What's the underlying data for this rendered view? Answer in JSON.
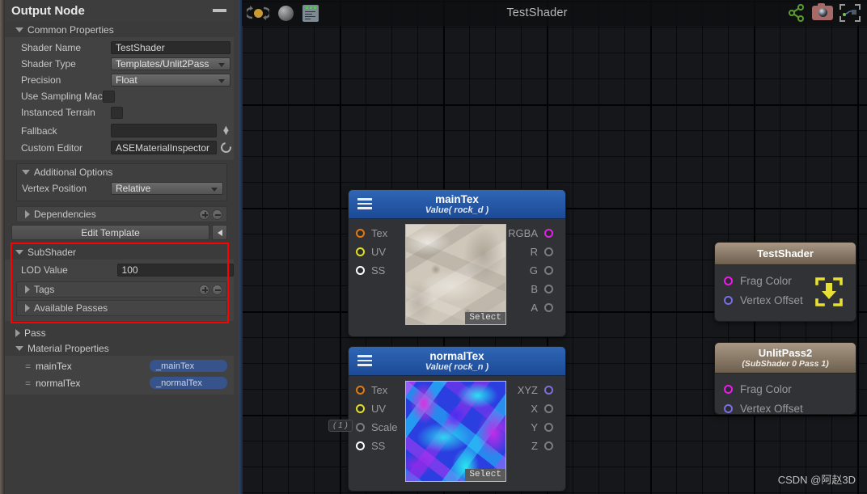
{
  "window": {
    "sidebar_title": "Output Node",
    "minimize_label": "minimize"
  },
  "toolbar": {
    "title": "TestShader",
    "icons": [
      "refresh-icon",
      "sphere-preview-icon",
      "document-icon"
    ],
    "right_icons": [
      "share-icon",
      "camera-icon",
      "focus-icon"
    ]
  },
  "sidebar": {
    "common_properties": {
      "label": "Common Properties",
      "fields": [
        {
          "label": "Shader Name",
          "value": "TestShader",
          "type": "text"
        },
        {
          "label": "Shader Type",
          "value": "Templates/Unlit2Pass",
          "type": "dropdown"
        },
        {
          "label": "Precision",
          "value": "Float",
          "type": "dropdown"
        },
        {
          "label": "Use Sampling Mac",
          "value": "",
          "type": "checkbox"
        },
        {
          "label": "Instanced Terrain",
          "value": "",
          "type": "checkbox"
        },
        {
          "label": "Fallback",
          "value": "",
          "type": "object"
        },
        {
          "label": "Custom Editor",
          "value": "ASEMaterialInspector",
          "type": "text"
        }
      ]
    },
    "additional_options": {
      "label": "Additional Options",
      "vertex_position_label": "Vertex Position",
      "vertex_position_value": "Relative"
    },
    "dependencies_label": "Dependencies",
    "edit_template_label": "Edit Template",
    "subshader": {
      "label": "SubShader",
      "lod_label": "LOD Value",
      "lod_value": "100",
      "tags_label": "Tags",
      "available_passes_label": "Available Passes"
    },
    "pass_label": "Pass",
    "material_properties": {
      "label": "Material Properties",
      "rows": [
        {
          "name": "mainTex",
          "property": "_mainTex"
        },
        {
          "name": "normalTex",
          "property": "_normalTex"
        }
      ]
    }
  },
  "graph": {
    "nodes": [
      {
        "id": "mainTex",
        "title": "mainTex",
        "subtitle": "Value( rock_d )",
        "inputs": [
          {
            "label": "Tex",
            "color": "#e07a16"
          },
          {
            "label": "UV",
            "color": "#e6e016"
          },
          {
            "label": "SS",
            "color": "#ffffff"
          }
        ],
        "outputs": [
          {
            "label": "RGBA",
            "color": "#e81ee8"
          },
          {
            "label": "R",
            "color": "#7c7c7c"
          },
          {
            "label": "G",
            "color": "#7c7c7c"
          },
          {
            "label": "B",
            "color": "#7c7c7c"
          },
          {
            "label": "A",
            "color": "#7c7c7c"
          }
        ],
        "select_label": "Select"
      },
      {
        "id": "normalTex",
        "title": "normalTex",
        "subtitle": "Value( rock_n )",
        "inputs": [
          {
            "label": "Tex",
            "color": "#e07a16"
          },
          {
            "label": "UV",
            "color": "#e6e016"
          },
          {
            "label": "Scale",
            "color": "#7c7c7c"
          },
          {
            "label": "SS",
            "color": "#ffffff"
          }
        ],
        "outputs": [
          {
            "label": "XYZ",
            "color": "#7a6fe0"
          },
          {
            "label": "X",
            "color": "#7c7c7c"
          },
          {
            "label": "Y",
            "color": "#7c7c7c"
          },
          {
            "label": "Z",
            "color": "#7c7c7c"
          }
        ],
        "select_label": "Select"
      },
      {
        "id": "testShaderMaster",
        "title": "TestShader",
        "subtitle": "",
        "inputs": [
          {
            "label": "Frag Color",
            "color": "#e81ee8"
          },
          {
            "label": "Vertex Offset",
            "color": "#7a6fe0"
          }
        ]
      },
      {
        "id": "unlitPass2",
        "title": "UnlitPass2",
        "subtitle": "(SubShader 0 Pass 1)",
        "inputs": [
          {
            "label": "Frag Color",
            "color": "#e81ee8"
          },
          {
            "label": "Vertex Offset",
            "color": "#7a6fe0"
          }
        ]
      }
    ],
    "tooltip_badge": "( 1 )",
    "watermark": "CSDN @阿赵3D"
  },
  "colors": {
    "highlight_box": "#ff0000",
    "node_header_blue": "#2f66b5",
    "node_header_tan": "#a89785",
    "property_pill": "#36538c",
    "sidebar_bg": "#3b3b3b",
    "graph_bg": "#16171a"
  }
}
